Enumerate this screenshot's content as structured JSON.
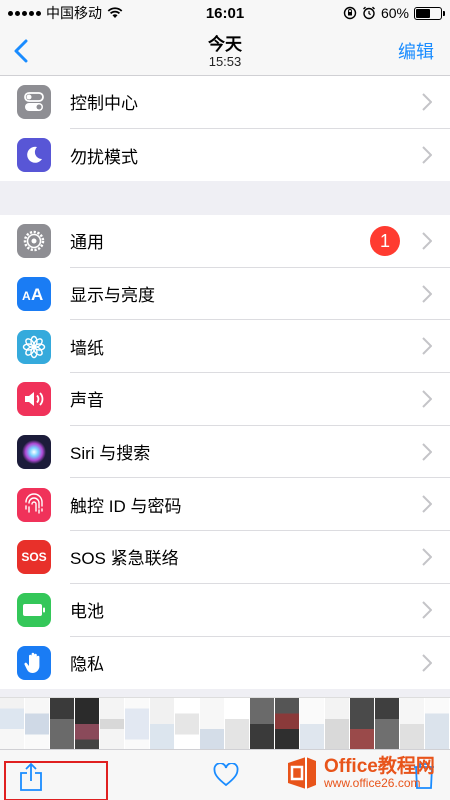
{
  "status_bar": {
    "carrier": "中国移动",
    "time": "16:01",
    "battery_percent": "60%",
    "battery_level": 0.6
  },
  "nav": {
    "title": "今天",
    "subtitle": "15:53",
    "edit_label": "编辑",
    "back_icon": "chevron-left-icon"
  },
  "settings": {
    "group1": [
      {
        "label": "控制中心",
        "icon": "control-center-icon",
        "color": "#8e8e93"
      },
      {
        "label": "勿扰模式",
        "icon": "moon-icon",
        "color": "#5856d6"
      }
    ],
    "group2": [
      {
        "label": "通用",
        "icon": "gear-icon",
        "color": "#8e8e93",
        "badge": "1"
      },
      {
        "label": "显示与亮度",
        "icon": "display-aa-icon",
        "color": "#1a7cf4"
      },
      {
        "label": "墙纸",
        "icon": "wallpaper-flower-icon",
        "color": "#35aadc"
      },
      {
        "label": "声音",
        "icon": "speaker-icon",
        "color": "#f0325a"
      },
      {
        "label": "Siri 与搜索",
        "icon": "siri-icon",
        "color": "#1c1c3a"
      },
      {
        "label": "触控 ID 与密码",
        "icon": "fingerprint-icon",
        "color": "#f0325a"
      },
      {
        "label": "SOS 紧急联络",
        "icon": "sos-icon",
        "color": "#e8302a"
      },
      {
        "label": "电池",
        "icon": "battery-icon",
        "color": "#34c759"
      },
      {
        "label": "隐私",
        "icon": "hand-icon",
        "color": "#1a7cf4"
      }
    ],
    "sos_text": "SOS"
  },
  "toolbar": {
    "share_icon": "share-icon",
    "favorite_icon": "heart-icon",
    "delete_icon": "trash-icon"
  },
  "watermark": {
    "title": "Office教程网",
    "url": "www.office26.com"
  },
  "colors": {
    "accent": "#1a8cff",
    "badge": "#ff3b30",
    "highlight": "#e02020"
  }
}
